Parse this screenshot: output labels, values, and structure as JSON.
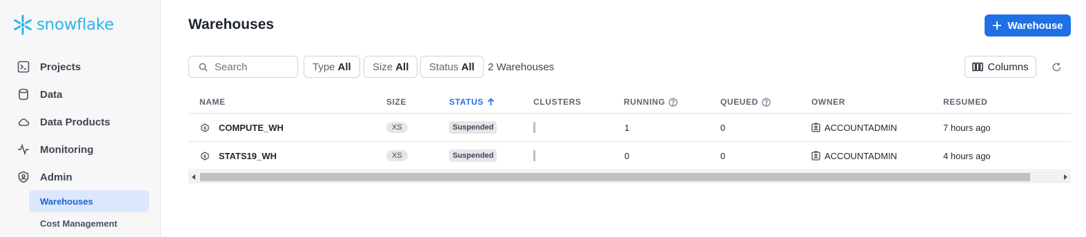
{
  "brand": {
    "name": "snowflake",
    "color": "#29b5e8"
  },
  "nav": {
    "items": [
      {
        "label": "Projects",
        "icon": "terminal-icon"
      },
      {
        "label": "Data",
        "icon": "database-icon"
      },
      {
        "label": "Data Products",
        "icon": "cloud-icon"
      },
      {
        "label": "Monitoring",
        "icon": "activity-icon"
      },
      {
        "label": "Admin",
        "icon": "shield-icon"
      }
    ],
    "sub_items": [
      {
        "label": "Warehouses",
        "active": true
      },
      {
        "label": "Cost Management",
        "active": false
      }
    ]
  },
  "header": {
    "title": "Warehouses",
    "add_button_label": "Warehouse"
  },
  "toolbar": {
    "search_placeholder": "Search",
    "filters": [
      {
        "label": "Type",
        "value": "All"
      },
      {
        "label": "Size",
        "value": "All"
      },
      {
        "label": "Status",
        "value": "All"
      }
    ],
    "count_text": "2 Warehouses",
    "columns_label": "Columns"
  },
  "table": {
    "columns": [
      "NAME",
      "SIZE",
      "STATUS",
      "CLUSTERS",
      "RUNNING",
      "QUEUED",
      "OWNER",
      "RESUMED"
    ],
    "sorted_column": "STATUS",
    "rows": [
      {
        "name": "COMPUTE_WH",
        "size": "XS",
        "status": "Suspended",
        "running": "1",
        "queued": "0",
        "owner": "ACCOUNTADMIN",
        "resumed": "7 hours ago"
      },
      {
        "name": "STATS19_WH",
        "size": "XS",
        "status": "Suspended",
        "running": "0",
        "queued": "0",
        "owner": "ACCOUNTADMIN",
        "resumed": "4 hours ago"
      }
    ]
  },
  "colors": {
    "accent": "#1f6fe5",
    "active_nav_bg": "#dbe8fc"
  }
}
